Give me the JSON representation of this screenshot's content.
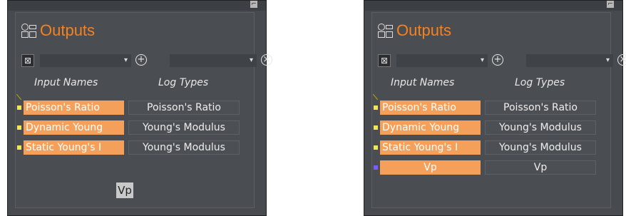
{
  "panels": [
    {
      "title": "Outputs",
      "headers": {
        "input_names": "Input Names",
        "log_types": "Log Types"
      },
      "rows": [
        {
          "input": "Poisson's Ratio",
          "log": "Poisson's Ratio",
          "marker_color": "#f1e65a"
        },
        {
          "input": "Dynamic Young",
          "log": "Young's Modulus",
          "marker_color": "#f1e65a"
        },
        {
          "input": "Static Young's I",
          "log": "Young's Modulus",
          "marker_color": "#f1e65a"
        }
      ],
      "vp_chip": "Vp"
    },
    {
      "title": "Outputs",
      "headers": {
        "input_names": "Input Names",
        "log_types": "Log Types"
      },
      "rows": [
        {
          "input": "Poisson's Ratio",
          "log": "Poisson's Ratio",
          "marker_color": "#f1e65a"
        },
        {
          "input": "Dynamic Young",
          "log": "Young's Modulus",
          "marker_color": "#f1e65a"
        },
        {
          "input": "Static Young's I",
          "log": "Young's Modulus",
          "marker_color": "#f1e65a"
        },
        {
          "input": "Vp",
          "log": "Vp",
          "marker_color": "#7b5cff"
        }
      ]
    }
  ],
  "colors": {
    "accent_orange": "#f5821f",
    "row_highlight": "#f5a05a",
    "panel_bg": "#474a4f"
  },
  "icons": {
    "add": "+",
    "remove": "⊗",
    "dropdown": "▾",
    "stat": "stat-icon"
  }
}
